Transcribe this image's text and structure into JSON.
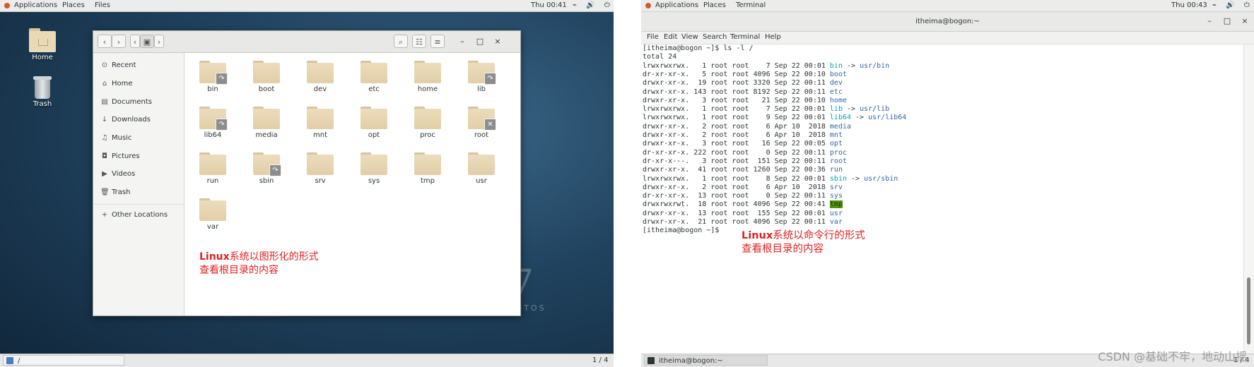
{
  "left_screen": {
    "topbar": {
      "applications": "Applications",
      "places": "Places",
      "app_name": "Files",
      "clock": "Thu 00:41",
      "system_icons": "⌁ 🔊 ⏻"
    },
    "desktop_icons": {
      "home": "Home",
      "trash": "Trash"
    },
    "file_manager": {
      "back_glyph": "‹",
      "forward_glyph": "›",
      "path_left_glyph": "‹",
      "path_right_glyph": "›",
      "path_drive_glyph": "▣",
      "search_glyph": "⌕",
      "view_options_glyph": "☷",
      "menu_glyph": "≡",
      "minimize_glyph": "–",
      "maximize_glyph": "□",
      "close_glyph": "×",
      "sidebar": [
        {
          "label": "Recent",
          "icon": "⊙"
        },
        {
          "label": "Home",
          "icon": "⌂"
        },
        {
          "label": "Documents",
          "icon": "▤"
        },
        {
          "label": "Downloads",
          "icon": "↓"
        },
        {
          "label": "Music",
          "icon": "♫"
        },
        {
          "label": "Pictures",
          "icon": "◘"
        },
        {
          "label": "Videos",
          "icon": "▶"
        },
        {
          "label": "Trash",
          "icon": "🗑"
        }
      ],
      "other_locations": {
        "label": "Other Locations",
        "icon": "+"
      },
      "folders": [
        {
          "name": "bin",
          "emblem": "↷"
        },
        {
          "name": "boot"
        },
        {
          "name": "dev"
        },
        {
          "name": "etc"
        },
        {
          "name": "home"
        },
        {
          "name": "lib",
          "emblem": "↷"
        },
        {
          "name": "lib64",
          "emblem": "↷"
        },
        {
          "name": "media"
        },
        {
          "name": "mnt"
        },
        {
          "name": "opt"
        },
        {
          "name": "proc"
        },
        {
          "name": "root",
          "emblem": "✕"
        },
        {
          "name": "run"
        },
        {
          "name": "sbin",
          "emblem": "↷"
        },
        {
          "name": "srv"
        },
        {
          "name": "sys"
        },
        {
          "name": "tmp"
        },
        {
          "name": "usr"
        },
        {
          "name": "var"
        }
      ],
      "annotation": {
        "latin": "Linux",
        "line1_rest": "系统以图形化的形式",
        "line2": "查看根目录的内容"
      }
    },
    "watermark": {
      "digit": "7",
      "text": "NTOS"
    },
    "taskbar": {
      "task_label": "/",
      "pager": "1 / 4"
    }
  },
  "right_screen": {
    "topbar": {
      "applications": "Applications",
      "places": "Places",
      "app_name": "Terminal",
      "clock": "Thu 00:43",
      "system_icons": "⌁ 🔊 ⏻"
    },
    "window_title": "itheima@bogon:~",
    "minimize_glyph": "–",
    "maximize_glyph": "□",
    "close_glyph": "×",
    "menu": [
      "File",
      "Edit",
      "View",
      "Search",
      "Terminal",
      "Help"
    ],
    "terminal": {
      "command": "[itheima@bogon ~]$ ls -l /",
      "total": "total 24",
      "entries": [
        {
          "meta": "lrwxrwxrwx.   1 root root    7 Sep 22 00:01 ",
          "name": "bin",
          "kind": "link",
          "target": "usr/bin"
        },
        {
          "meta": "dr-xr-xr-x.   5 root root 4096 Sep 22 00:10 ",
          "name": "boot",
          "kind": "dir"
        },
        {
          "meta": "drwxr-xr-x.  19 root root 3320 Sep 22 00:11 ",
          "name": "dev",
          "kind": "dir"
        },
        {
          "meta": "drwxr-xr-x. 143 root root 8192 Sep 22 00:11 ",
          "name": "etc",
          "kind": "dir"
        },
        {
          "meta": "drwxr-xr-x.   3 root root   21 Sep 22 00:10 ",
          "name": "home",
          "kind": "dir"
        },
        {
          "meta": "lrwxrwxrwx.   1 root root    7 Sep 22 00:01 ",
          "name": "lib",
          "kind": "link",
          "target": "usr/lib"
        },
        {
          "meta": "lrwxrwxrwx.   1 root root    9 Sep 22 00:01 ",
          "name": "lib64",
          "kind": "link",
          "target": "usr/lib64"
        },
        {
          "meta": "drwxr-xr-x.   2 root root    6 Apr 10  2018 ",
          "name": "media",
          "kind": "dir"
        },
        {
          "meta": "drwxr-xr-x.   2 root root    6 Apr 10  2018 ",
          "name": "mnt",
          "kind": "dir"
        },
        {
          "meta": "drwxr-xr-x.   3 root root   16 Sep 22 00:05 ",
          "name": "opt",
          "kind": "dir"
        },
        {
          "meta": "dr-xr-xr-x. 222 root root    0 Sep 22 00:11 ",
          "name": "proc",
          "kind": "dir"
        },
        {
          "meta": "dr-xr-x---.   3 root root  151 Sep 22 00:11 ",
          "name": "root",
          "kind": "dir"
        },
        {
          "meta": "drwxr-xr-x.  41 root root 1260 Sep 22 00:36 ",
          "name": "run",
          "kind": "dir"
        },
        {
          "meta": "lrwxrwxrwx.   1 root root    8 Sep 22 00:01 ",
          "name": "sbin",
          "kind": "link",
          "target": "usr/sbin"
        },
        {
          "meta": "drwxr-xr-x.   2 root root    6 Apr 10  2018 ",
          "name": "srv",
          "kind": "dir"
        },
        {
          "meta": "dr-xr-xr-x.  13 root root    0 Sep 22 00:11 ",
          "name": "sys",
          "kind": "dir"
        },
        {
          "meta": "drwxrwxrwt.  18 root root 4096 Sep 22 00:41 ",
          "name": "tmp",
          "kind": "sticky"
        },
        {
          "meta": "drwxr-xr-x.  13 root root  155 Sep 22 00:01 ",
          "name": "usr",
          "kind": "dir"
        },
        {
          "meta": "drwxr-xr-x.  21 root root 4096 Sep 22 00:11 ",
          "name": "var",
          "kind": "dir"
        }
      ],
      "prompt": "[itheima@bogon ~]$ "
    },
    "annotation": {
      "latin": "Linux",
      "line1_rest": "系统以命令行的形式",
      "line2": "查看根目录的内容"
    },
    "taskbar": {
      "task_label": "itheima@bogon:~",
      "pager": "1 / 4"
    },
    "csdn_watermark": "CSDN @基础不牢，地动山摇"
  },
  "colors": {
    "link": "#00a6b2",
    "directory": "#3465a4",
    "sticky_bg": "#4e9a06",
    "annotation": "#e02020"
  }
}
